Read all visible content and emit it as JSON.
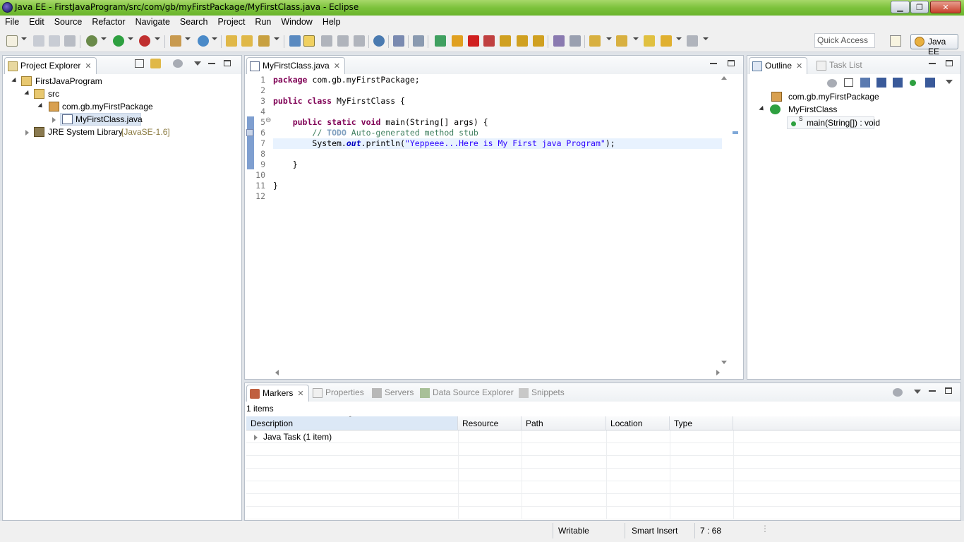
{
  "window": {
    "title": "Java EE - FirstJavaProgram/src/com/gb/myFirstPackage/MyFirstClass.java - Eclipse",
    "min_glyph": "▁",
    "max_glyph": "❐",
    "close_glyph": "✕"
  },
  "menu": [
    "File",
    "Edit",
    "Source",
    "Refactor",
    "Navigate",
    "Search",
    "Project",
    "Run",
    "Window",
    "Help"
  ],
  "toolbar": {
    "quick_access_placeholder": "Quick Access",
    "perspective": "Java EE"
  },
  "project_explorer": {
    "tab_label": "Project Explorer",
    "tree": {
      "project": "FirstJavaProgram",
      "src": "src",
      "package": "com.gb.myFirstPackage",
      "file": "MyFirstClass.java",
      "jre": "JRE System Library",
      "jre_version": "[JavaSE-1.6]"
    }
  },
  "editor": {
    "tab_label": "MyFirstClass.java",
    "line_numbers": [
      "1",
      "2",
      "3",
      "4",
      "5",
      "6",
      "7",
      "8",
      "9",
      "10",
      "11",
      "12"
    ],
    "fold_marker": "⊖",
    "code": {
      "l1_kw": "package",
      "l1_rest": " com.gb.myFirstPackage;",
      "l3_kw1": "public",
      "l3_kw2": "class",
      "l3_rest": " MyFirstClass {",
      "l5_indent": "    ",
      "l5_kw1": "public",
      "l5_kw2": "static",
      "l5_kw3": "void",
      "l5_rest": " main(String[] args) {",
      "l6_indent": "        ",
      "l6_comment_start": "// ",
      "l6_todo": "TODO",
      "l6_comment_rest": " Auto-generated method stub",
      "l7_indent": "        ",
      "l7_a": "System.",
      "l7_field": "out",
      "l7_b": ".println(",
      "l7_str": "\"Yeppeee...Here is My First java Program\"",
      "l7_c": ");",
      "l9": "    }",
      "l11": "}"
    }
  },
  "outline": {
    "tab_label": "Outline",
    "tab2_label": "Task List",
    "package": "com.gb.myFirstPackage",
    "class": "MyFirstClass",
    "method_modifier": "S",
    "method": "main(String[]) : void"
  },
  "bottom_panel": {
    "tabs": [
      "Markers",
      "Properties",
      "Servers",
      "Data Source Explorer",
      "Snippets"
    ],
    "count": "1 items",
    "columns": [
      "Description",
      "Resource",
      "Path",
      "Location",
      "Type"
    ],
    "rows": [
      {
        "description": "Java Task (1 item)"
      }
    ]
  },
  "status": {
    "writable": "Writable",
    "insert_mode": "Smart Insert",
    "position": "7 : 68"
  },
  "colors": {
    "keyword": "#7f0055",
    "comment": "#3f7f5f",
    "string": "#2a00ff",
    "title_bar": "#7cc23c"
  }
}
